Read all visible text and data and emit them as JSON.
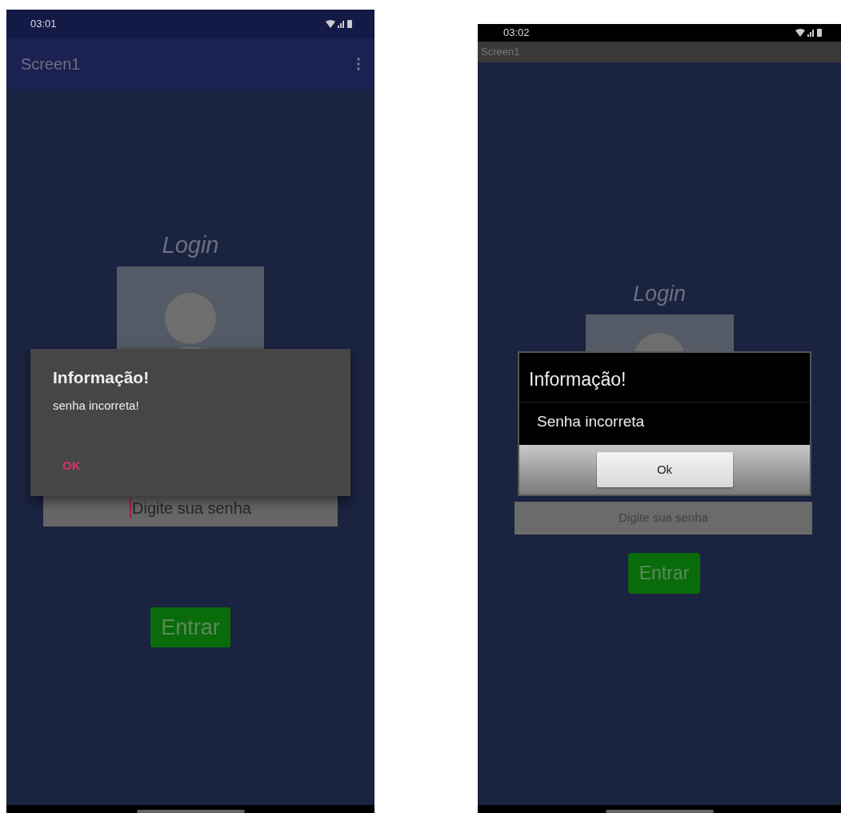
{
  "screens": [
    {
      "kind": "material",
      "status_bar": {
        "time": "03:01"
      },
      "app_bar": {
        "title": "Screen1",
        "menu": true
      },
      "heading": "Login",
      "password_field": {
        "placeholder": "Digite sua senha",
        "focused": true
      },
      "button": "Entrar",
      "dialog": {
        "title": "Informação!",
        "message": "senha incorreta!",
        "button": "OK"
      }
    },
    {
      "kind": "holo",
      "status_bar": {
        "time": "03:02"
      },
      "app_bar": {
        "title": "Screen1",
        "menu": false
      },
      "heading": "Login",
      "password_field": {
        "placeholder": "Digite sua senha",
        "focused": false
      },
      "button": "Entrar",
      "dialog": {
        "title": "Informação!",
        "message": "Senha incorreta",
        "button": "Ok"
      }
    }
  ]
}
